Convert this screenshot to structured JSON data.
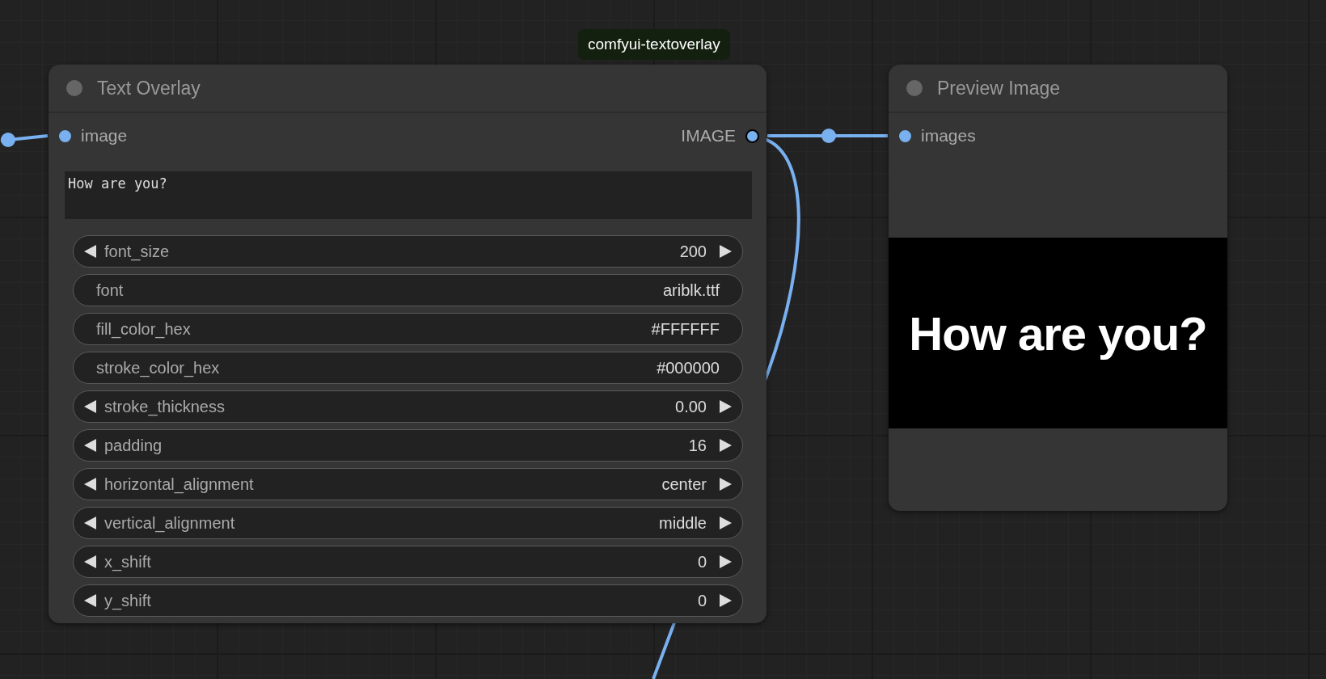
{
  "badge": "comfyui-textoverlay",
  "text_overlay_node": {
    "title": "Text Overlay",
    "input": "image",
    "output": "IMAGE",
    "text": "How are you?",
    "widgets": [
      {
        "kind": "number",
        "label": "font_size",
        "value": "200"
      },
      {
        "kind": "text",
        "label": "font",
        "value": "ariblk.ttf"
      },
      {
        "kind": "text",
        "label": "fill_color_hex",
        "value": "#FFFFFF"
      },
      {
        "kind": "text",
        "label": "stroke_color_hex",
        "value": "#000000"
      },
      {
        "kind": "number",
        "label": "stroke_thickness",
        "value": "0.00"
      },
      {
        "kind": "number",
        "label": "padding",
        "value": "16"
      },
      {
        "kind": "number",
        "label": "horizontal_alignment",
        "value": "center"
      },
      {
        "kind": "number",
        "label": "vertical_alignment",
        "value": "middle"
      },
      {
        "kind": "number",
        "label": "x_shift",
        "value": "0"
      },
      {
        "kind": "number",
        "label": "y_shift",
        "value": "0"
      }
    ]
  },
  "preview_node": {
    "title": "Preview Image",
    "input": "images",
    "image_text": "How are you?"
  }
}
